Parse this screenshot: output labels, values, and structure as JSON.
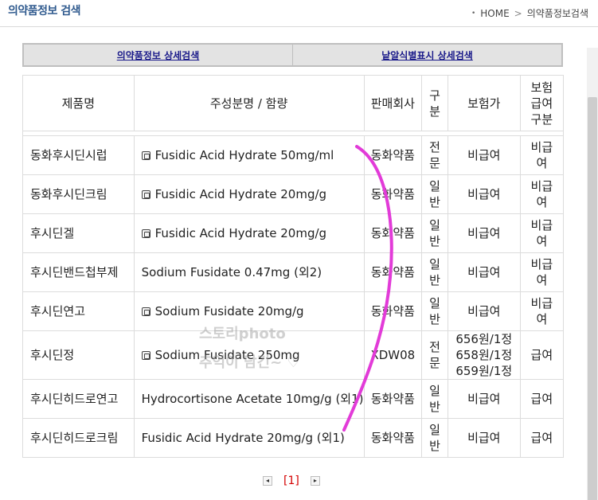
{
  "header": {
    "title": "의약품정보 검색",
    "breadcrumb": [
      "HOME",
      ">",
      "의약품정보검색"
    ]
  },
  "search_tabs": [
    {
      "label": "의약품정보 상세검색"
    },
    {
      "label": "낱알식별표시 상세검색"
    }
  ],
  "table": {
    "headers": [
      "제품명",
      "주성분명 / 함량",
      "판매회사",
      "구분",
      "보험가",
      "보험급여구분"
    ],
    "header_lines": {
      "classification": [
        "구",
        "분"
      ],
      "coverage": [
        "보험",
        "급여",
        "구분"
      ]
    },
    "rows": [
      {
        "name": "동화후시딘시럽",
        "ingredient": "Fusidic Acid Hydrate 50mg/ml",
        "icon": true,
        "company": "동화약품",
        "class": [
          "전",
          "문"
        ],
        "price": [
          "비급여"
        ],
        "coverage": [
          "비급",
          "여"
        ]
      },
      {
        "name": "동화후시딘크림",
        "ingredient": "Fusidic Acid Hydrate 20mg/g",
        "icon": true,
        "company": "동화약품",
        "class": [
          "일",
          "반"
        ],
        "price": [
          "비급여"
        ],
        "coverage": [
          "비급",
          "여"
        ]
      },
      {
        "name": "후시딘겔",
        "ingredient": "Fusidic Acid Hydrate 20mg/g",
        "icon": true,
        "company": "동화약품",
        "class": [
          "일",
          "반"
        ],
        "price": [
          "비급여"
        ],
        "coverage": [
          "비급",
          "여"
        ]
      },
      {
        "name": "후시딘밴드첩부제",
        "ingredient": "Sodium Fusidate 0.47mg (외2)",
        "icon": false,
        "company": "동화약품",
        "class": [
          "일",
          "반"
        ],
        "price": [
          "비급여"
        ],
        "coverage": [
          "비급",
          "여"
        ]
      },
      {
        "name": "후시딘연고",
        "ingredient": "Sodium Fusidate 20mg/g",
        "icon": true,
        "company": "동화약품",
        "class": [
          "일",
          "반"
        ],
        "price": [
          "비급여"
        ],
        "coverage": [
          "비급",
          "여"
        ]
      },
      {
        "name": "후시딘정",
        "ingredient": "Sodium Fusidate 250mg",
        "icon": true,
        "company": "XDW08",
        "class": [
          "전",
          "문"
        ],
        "price": [
          "656원/1정",
          "658원/1정",
          "659원/1정"
        ],
        "coverage": [
          "급여"
        ]
      },
      {
        "name": "후시딘히드로연고",
        "ingredient": "Hydrocortisone Acetate 10mg/g (외1)",
        "icon": false,
        "company": "동화약품",
        "class": [
          "일",
          "반"
        ],
        "price": [
          "비급여"
        ],
        "coverage": [
          "급여"
        ]
      },
      {
        "name": "후시딘히드로크림",
        "ingredient": "Fusidic Acid Hydrate 20mg/g (외1)",
        "icon": false,
        "company": "동화약품",
        "class": [
          "일",
          "반"
        ],
        "price": [
          "비급여"
        ],
        "coverage": [
          "급여"
        ]
      }
    ]
  },
  "pagination": {
    "current": "[1]",
    "prev_icon": "prev-arrow-icon",
    "next_icon": "next-arrow-icon"
  },
  "watermark": [
    "스토리photo",
    "추억이 담긴~ ♡"
  ],
  "colors": {
    "title": "#2f5a8e",
    "tab_link": "#1a1a8a",
    "current_page": "#d40000",
    "scribble": "#e23bd8"
  }
}
